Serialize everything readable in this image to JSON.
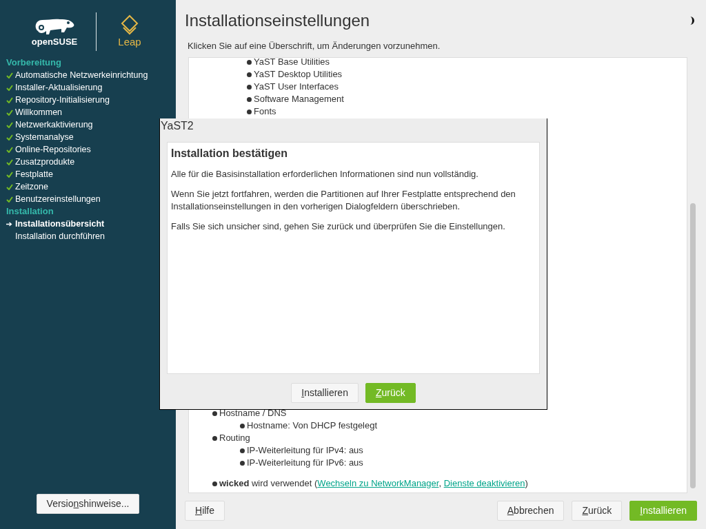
{
  "sidebar": {
    "logo": {
      "brand": "openSUSE",
      "product": "Leap"
    },
    "sections": [
      {
        "title": "Vorbereitung",
        "items": [
          {
            "label": "Automatische Netzwerkeinrichtung",
            "kind": "done"
          },
          {
            "label": "Installer-Aktualisierung",
            "kind": "done"
          },
          {
            "label": "Repository-Initialisierung",
            "kind": "done"
          },
          {
            "label": "Willkommen",
            "kind": "done"
          },
          {
            "label": "Netzwerkaktivierung",
            "kind": "done"
          },
          {
            "label": "Systemanalyse",
            "kind": "done"
          },
          {
            "label": "Online-Repositories",
            "kind": "done"
          },
          {
            "label": "Zusatzprodukte",
            "kind": "done"
          },
          {
            "label": "Festplatte",
            "kind": "done"
          },
          {
            "label": "Zeitzone",
            "kind": "done"
          },
          {
            "label": "Benutzereinstellungen",
            "kind": "done"
          }
        ]
      },
      {
        "title": "Installation",
        "items": [
          {
            "label": "Installationsübersicht",
            "kind": "current"
          },
          {
            "label": "Installation durchführen",
            "kind": "pending"
          }
        ]
      }
    ],
    "release_notes_button": {
      "before": "Versio",
      "key": "n",
      "after": "shinweise...",
      "primary": false
    }
  },
  "main": {
    "title": "Installationseinstellungen",
    "hint": "Klicken Sie auf eine Überschrift, um Änderungen vorzunehmen.",
    "top_items": [
      "YaST Base Utilities",
      "YaST Desktop Utilities",
      "YaST User Interfaces",
      "Software Management",
      "Fonts"
    ],
    "bottom_items": [
      {
        "text": "Hostname / DNS",
        "children": [
          {
            "text": "Hostname: Von DHCP festgelegt"
          }
        ]
      },
      {
        "text": "Routing",
        "children": [
          {
            "text": "IP-Weiterleitung für IPv4: aus"
          },
          {
            "text": "IP-Weiterleitung für IPv6: aus"
          }
        ]
      }
    ],
    "network_line": {
      "text_before": "**wicked** wird verwendet (",
      "links": [
        "Wechseln zu NetworkManager",
        "Dienste deaktivieren"
      ],
      "separator": ", ",
      "text_after": ")"
    },
    "buttons": [
      {
        "key": "H",
        "after": "ilfe",
        "primary": false
      },
      {
        "key": "A",
        "after": "bbrechen",
        "primary": false
      },
      {
        "key": "Z",
        "after": "urück",
        "primary": false
      },
      {
        "key": "I",
        "after": "nstallieren",
        "primary": true
      }
    ]
  },
  "dialog": {
    "title": "YaST2",
    "heading": "Installation bestätigen",
    "paragraphs": [
      "Alle für die Basisinstallation erforderlichen Informationen sind nun vollständig.",
      "Wenn Sie jetzt fortfahren, werden die Partitionen auf Ihrer Festplatte entsprechend den Installationseinstellungen in den vorherigen Dialogfeldern überschrieben.",
      "Falls Sie sich unsicher sind, gehen Sie zurück und überprüfen Sie die Einstellungen."
    ],
    "buttons": [
      {
        "key": "I",
        "after": "nstallieren",
        "primary": false
      },
      {
        "key": "Z",
        "after": "urück",
        "primary": true
      }
    ]
  }
}
